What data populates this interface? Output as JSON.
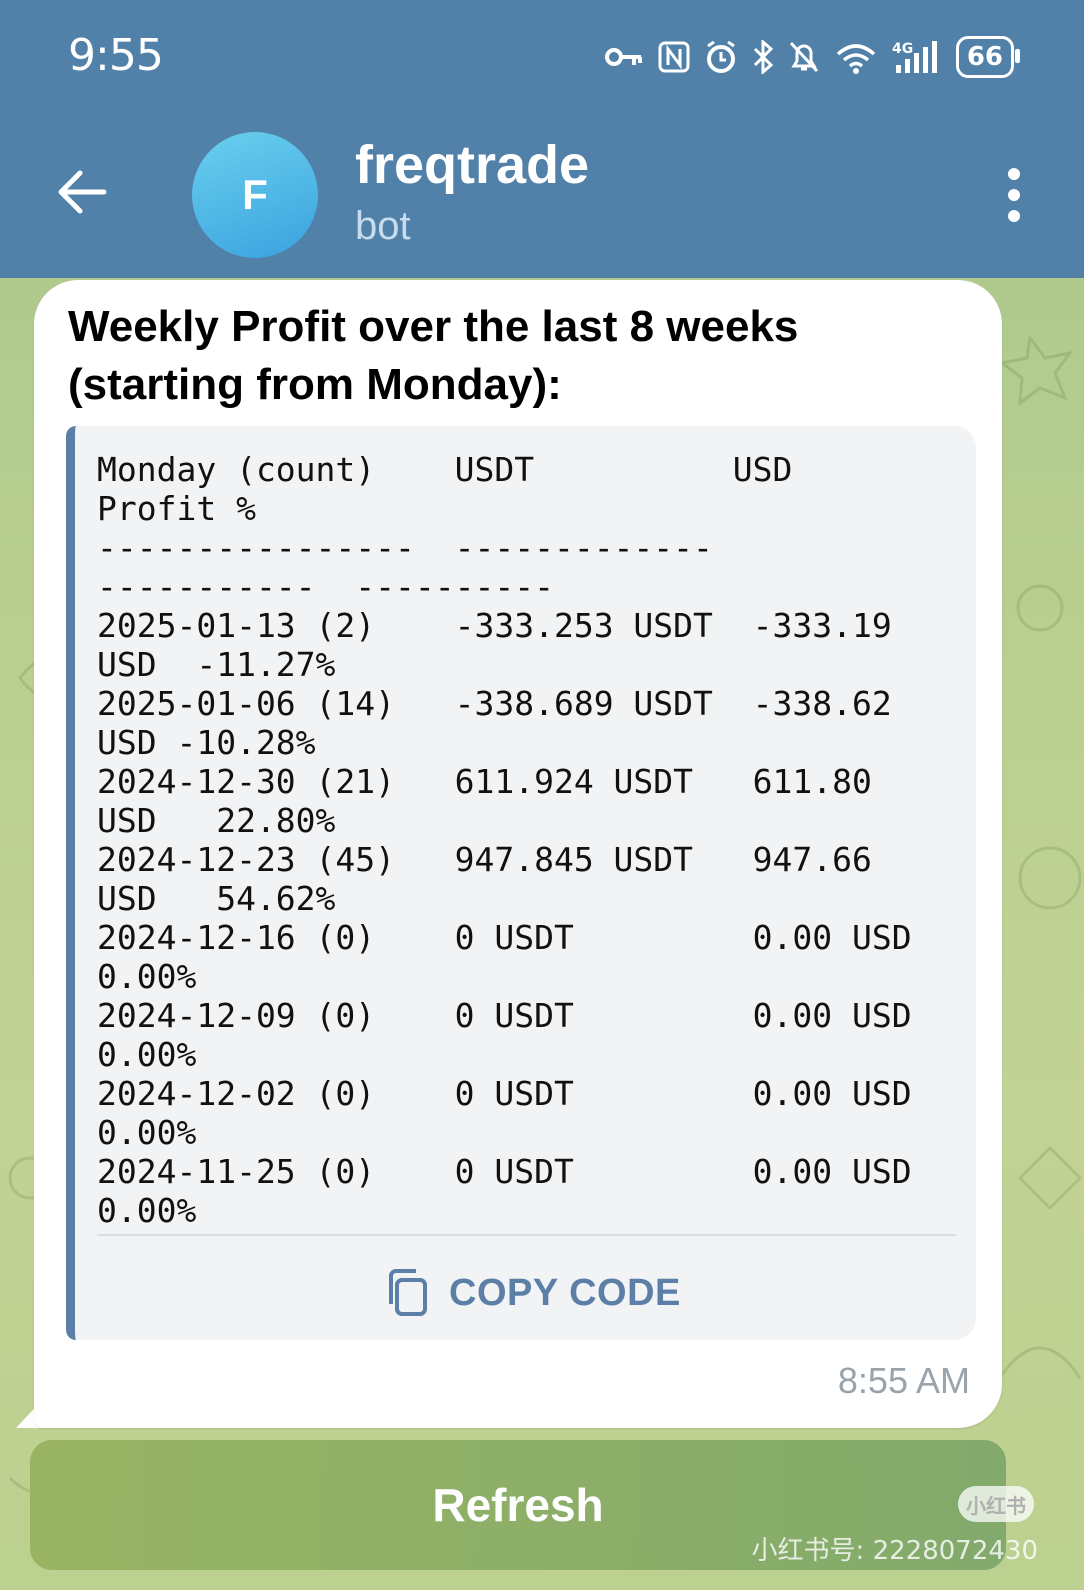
{
  "status_bar": {
    "time": "9:55",
    "network": "4G",
    "battery": "66",
    "icons": [
      "key-icon",
      "nfc-icon",
      "alarm-icon",
      "bluetooth-icon",
      "mute-icon",
      "wifi-icon",
      "signal-icon",
      "battery-icon"
    ]
  },
  "header": {
    "avatar_letter": "F",
    "title": "freqtrade",
    "subtitle": "bot",
    "colors": {
      "bar": "#5180a8",
      "avatar": "#3aa2df"
    }
  },
  "message": {
    "title_lines": [
      "Weekly Profit over the last 8 weeks",
      "(starting from Monday):"
    ],
    "code_lines": [
      "Monday (count)    USDT          USD",
      "Profit %",
      "----------------  -------------",
      "-----------  ----------",
      "2025-01-13 (2)    -333.253 USDT  -333.19",
      "USD  -11.27%",
      "2025-01-06 (14)   -338.689 USDT  -338.62",
      "USD -10.28%",
      "2024-12-30 (21)   611.924 USDT   611.80",
      "USD   22.80%",
      "2024-12-23 (45)   947.845 USDT   947.66",
      "USD   54.62%",
      "2024-12-16 (0)    0 USDT         0.00 USD",
      "0.00%",
      "2024-12-09 (0)    0 USDT         0.00 USD",
      "0.00%",
      "2024-12-02 (0)    0 USDT         0.00 USD",
      "0.00%",
      "2024-11-25 (0)    0 USDT         0.00 USD",
      "0.00%"
    ],
    "copy_label": "COPY CODE",
    "time": "8:55 AM"
  },
  "keyboard": {
    "refresh_label": "Refresh"
  },
  "watermark": {
    "badge": "小红书",
    "text": "小红书号: 2228072430"
  }
}
